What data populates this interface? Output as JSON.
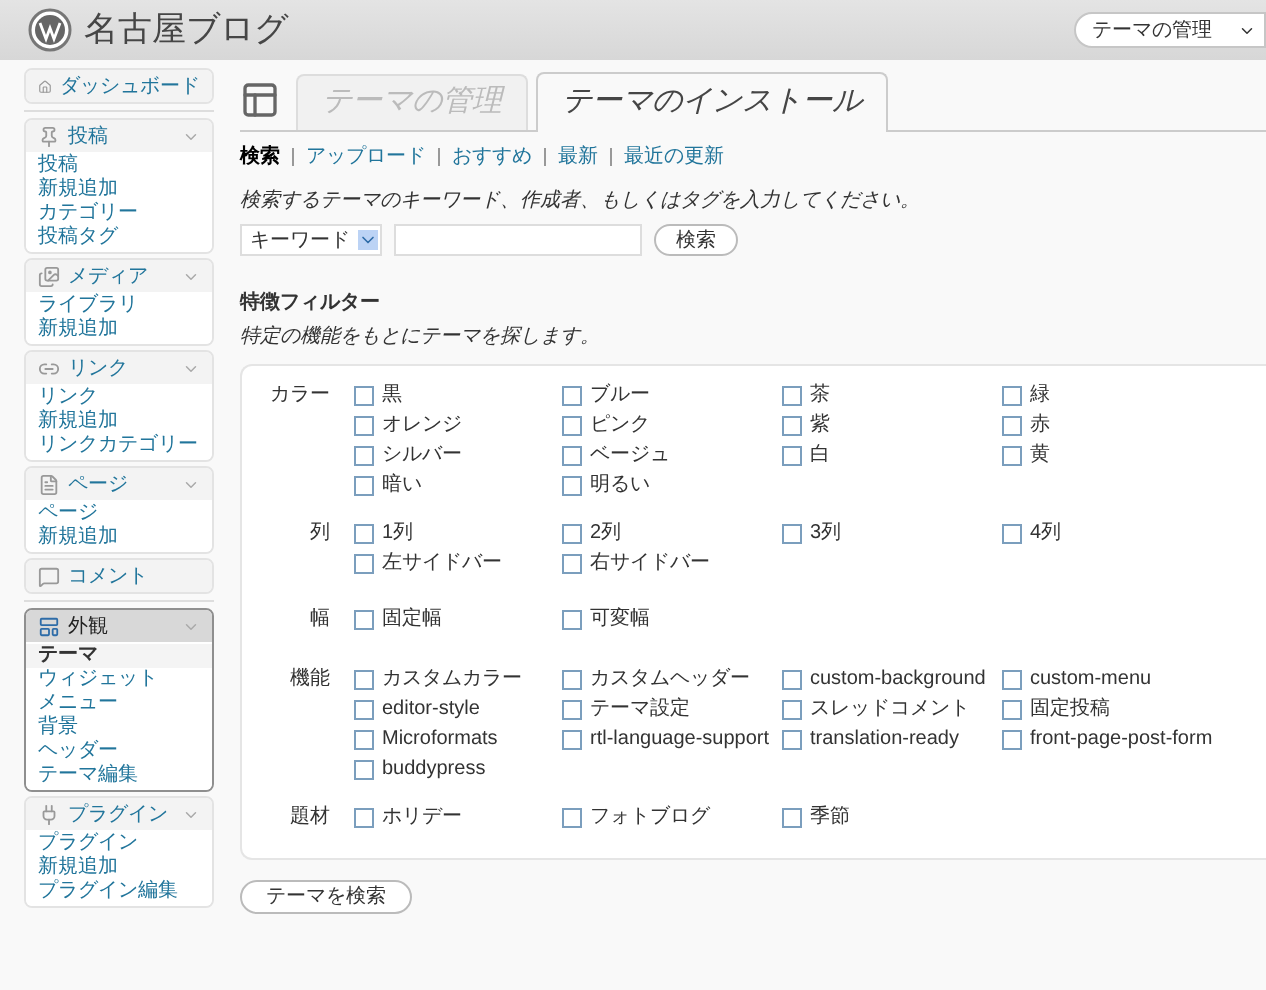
{
  "header": {
    "title": "名古屋ブログ",
    "favorites": {
      "label": "テーマの管理"
    }
  },
  "sidebar": {
    "groups": [
      [
        {
          "label": "ダッシュボード",
          "selected": false
        }
      ],
      [
        {
          "label": "投稿",
          "selected": false,
          "items": [
            {
              "label": "投稿",
              "selected": false
            },
            {
              "label": "新規追加",
              "selected": false
            },
            {
              "label": "カテゴリー",
              "selected": false
            },
            {
              "label": "投稿タグ",
              "selected": false
            }
          ]
        },
        {
          "label": "メディア",
          "selected": false,
          "items": [
            {
              "label": "ライブラリ",
              "selected": false
            },
            {
              "label": "新規追加",
              "selected": false
            }
          ]
        },
        {
          "label": "リンク",
          "selected": false,
          "items": [
            {
              "label": "リンク",
              "selected": false
            },
            {
              "label": "新規追加",
              "selected": false
            },
            {
              "label": "リンクカテゴリー",
              "selected": false
            }
          ]
        },
        {
          "label": "ページ",
          "selected": false,
          "items": [
            {
              "label": "ページ",
              "selected": false
            },
            {
              "label": "新規追加",
              "selected": false
            }
          ]
        },
        {
          "label": "コメント",
          "selected": false
        }
      ],
      [
        {
          "label": "外観",
          "selected": true,
          "items": [
            {
              "label": "テーマ",
              "selected": true
            },
            {
              "label": "ウィジェット",
              "selected": false
            },
            {
              "label": "メニュー",
              "selected": false
            },
            {
              "label": "背景",
              "selected": false
            },
            {
              "label": "ヘッダー",
              "selected": false
            },
            {
              "label": "テーマ編集",
              "selected": false
            }
          ]
        },
        {
          "label": "プラグイン",
          "selected": false,
          "items": [
            {
              "label": "プラグイン",
              "selected": false
            },
            {
              "label": "新規追加",
              "selected": false
            },
            {
              "label": "プラグイン編集",
              "selected": false
            }
          ]
        }
      ]
    ]
  },
  "tabs": [
    {
      "label": "テーマの管理",
      "selected": false
    },
    {
      "label": "テーマのインストール",
      "selected": true
    }
  ],
  "sub_links": [
    {
      "label": "検索",
      "selected": true
    },
    {
      "label": "アップロード",
      "selected": false
    },
    {
      "label": "おすすめ",
      "selected": false
    },
    {
      "label": "最新",
      "selected": false
    },
    {
      "label": "最近の更新",
      "selected": false
    }
  ],
  "search": {
    "intro": "検索するテーマのキーワード、作成者、もしくはタグを入力してください。",
    "type_select": "キーワード",
    "button": "検索"
  },
  "filter": {
    "title": "特徴フィルター",
    "description": "特定の機能をもとにテーマを探します。",
    "groups": [
      {
        "label": "カラー",
        "options": [
          {
            "label": "黒",
            "checked": false
          },
          {
            "label": "ブルー",
            "checked": false
          },
          {
            "label": "茶",
            "checked": false
          },
          {
            "label": "緑",
            "checked": false
          },
          {
            "label": "オレンジ",
            "checked": false
          },
          {
            "label": "ピンク",
            "checked": false
          },
          {
            "label": "紫",
            "checked": false
          },
          {
            "label": "赤",
            "checked": false
          },
          {
            "label": "シルバー",
            "checked": false
          },
          {
            "label": "ベージュ",
            "checked": false
          },
          {
            "label": "白",
            "checked": false
          },
          {
            "label": "黄",
            "checked": false
          },
          {
            "label": "暗い",
            "checked": false
          },
          {
            "label": "明るい",
            "checked": false
          }
        ]
      },
      {
        "label": "列",
        "options": [
          {
            "label": "1列",
            "checked": false
          },
          {
            "label": "2列",
            "checked": false
          },
          {
            "label": "3列",
            "checked": false
          },
          {
            "label": "4列",
            "checked": false
          },
          {
            "label": "左サイドバー",
            "checked": false
          },
          {
            "label": "右サイドバー",
            "checked": false
          }
        ]
      },
      {
        "label": "幅",
        "options": [
          {
            "label": "固定幅",
            "checked": false
          },
          {
            "label": "可変幅",
            "checked": false
          }
        ]
      },
      {
        "label": "機能",
        "options": [
          {
            "label": "カスタムカラー",
            "checked": false
          },
          {
            "label": "カスタムヘッダー",
            "checked": false
          },
          {
            "label": "custom-background",
            "checked": false
          },
          {
            "label": "custom-menu",
            "checked": false
          },
          {
            "label": "editor-style",
            "checked": false
          },
          {
            "label": "テーマ設定",
            "checked": false
          },
          {
            "label": "スレッドコメント",
            "checked": false
          },
          {
            "label": "固定投稿",
            "checked": false
          },
          {
            "label": "Microformats",
            "checked": false
          },
          {
            "label": "rtl-language-support",
            "checked": false
          },
          {
            "label": "translation-ready",
            "checked": false
          },
          {
            "label": "front-page-post-form",
            "checked": false
          },
          {
            "label": "buddypress",
            "checked": false
          }
        ]
      },
      {
        "label": "題材",
        "options": [
          {
            "label": "ホリデー",
            "checked": false
          },
          {
            "label": "フォトブログ",
            "checked": false
          },
          {
            "label": "季節",
            "checked": false
          }
        ]
      }
    ],
    "button": "テーマを検索"
  }
}
